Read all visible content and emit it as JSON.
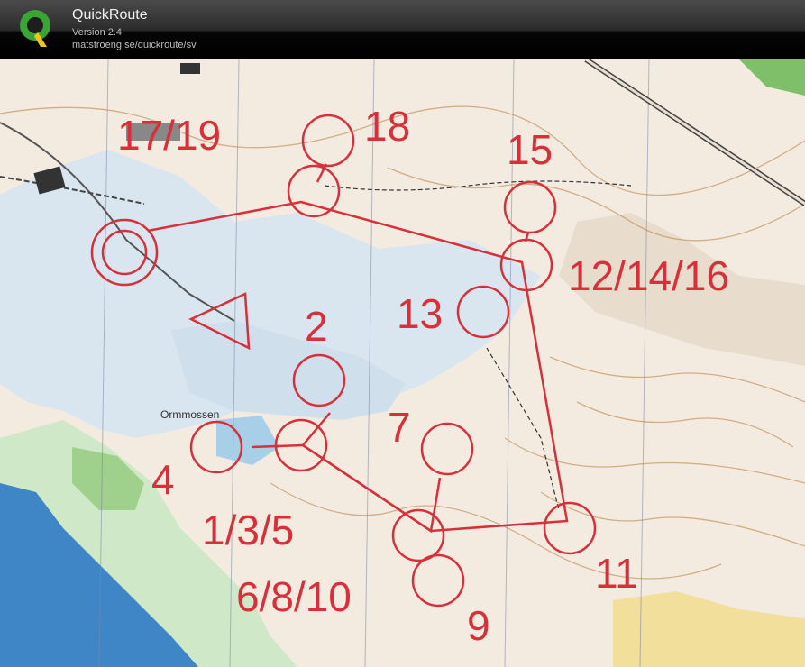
{
  "app": {
    "title": "QuickRoute",
    "version": "Version 2.4",
    "url": "matstroeng.se/quickroute/sv"
  },
  "map": {
    "place_name": "Ormmossen",
    "course_color": "#d8303a",
    "control_labels": {
      "c17_19": "17/19",
      "c18": "18",
      "c15": "15",
      "c12_14_16": "12/14/16",
      "c13": "13",
      "c2": "2",
      "c7": "7",
      "c4": "4",
      "c1_3_5": "1/3/5",
      "c6_8_10": "6/8/10",
      "c11": "11",
      "c9": "9"
    }
  }
}
